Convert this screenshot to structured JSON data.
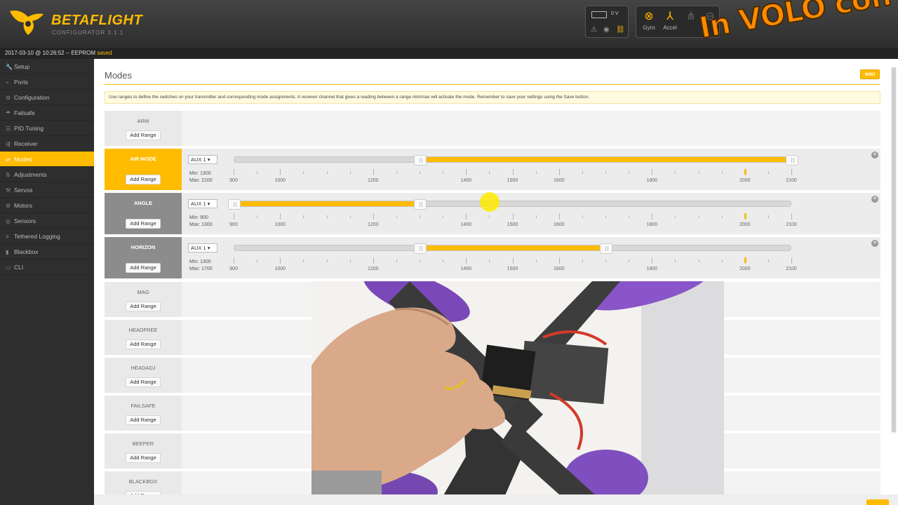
{
  "app": {
    "brand": "BETAFLIGHT",
    "subtitle": "CONFIGURATOR",
    "version": "3.1.1",
    "voltage": "0 V",
    "accent": "#ffbb00"
  },
  "sensors": [
    {
      "label": "Gyro",
      "icon": "gyro-icon",
      "active": true
    },
    {
      "label": "Accel",
      "icon": "accel-icon",
      "active": true
    }
  ],
  "watermark": "In VOLO con ISSAM",
  "logbar": {
    "timestamp": "2017-03-10 @ 10:26:52 -- EEPROM",
    "saved": "saved"
  },
  "sidebar": {
    "items": [
      {
        "label": "Setup",
        "icon": "wrench-icon"
      },
      {
        "label": "Ports",
        "icon": "plug-icon"
      },
      {
        "label": "Configuration",
        "icon": "gear-icon"
      },
      {
        "label": "Failsafe",
        "icon": "parachute-icon"
      },
      {
        "label": "PID Tuning",
        "icon": "sliders-icon"
      },
      {
        "label": "Receiver",
        "icon": "receiver-icon"
      },
      {
        "label": "Modes",
        "icon": "switch-icon",
        "active": true
      },
      {
        "label": "Adjustments",
        "icon": "adjust-icon"
      },
      {
        "label": "Servos",
        "icon": "servo-icon"
      },
      {
        "label": "Motors",
        "icon": "motor-icon"
      },
      {
        "label": "Sensors",
        "icon": "sensor-icon"
      },
      {
        "label": "Tethered Logging",
        "icon": "log-icon"
      },
      {
        "label": "Blackbox",
        "icon": "blackbox-icon"
      },
      {
        "label": "CLI",
        "icon": "terminal-icon"
      }
    ]
  },
  "main": {
    "title": "Modes",
    "wiki": "WIKI",
    "note": "Use ranges to define the switches on your transmitter and corresponding mode assignments. A receiver channel that gives a reading between a range min/max will activate the mode. Remember to save your settings using the Save button."
  },
  "modes": {
    "add_range_label": "Add Range",
    "ticks": [
      "900",
      "1000",
      "1200",
      "1400",
      "1500",
      "1600",
      "1800",
      "2000",
      "2100"
    ],
    "rows": [
      {
        "name": "ARM"
      },
      {
        "name": "AIR MODE",
        "aux": "AUX 1",
        "min_label": "Min: 1300",
        "max_label": "Max: 2100",
        "min": 1300,
        "max": 2100,
        "marker": 2000
      },
      {
        "name": "ANGLE",
        "aux": "AUX 1",
        "min_label": "Min: 900",
        "max_label": "Max: 1300",
        "min": 900,
        "max": 1300,
        "marker": 2000
      },
      {
        "name": "HORIZON",
        "aux": "AUX 1",
        "min_label": "Min: 1300",
        "max_label": "Max: 1700",
        "min": 1300,
        "max": 1700,
        "marker": 2000
      },
      {
        "name": "MAG"
      },
      {
        "name": "HEADFREE"
      },
      {
        "name": "HEADADJ"
      },
      {
        "name": "FAILSAFE"
      },
      {
        "name": "BEEPER"
      },
      {
        "name": "BLACKBOX"
      }
    ]
  }
}
